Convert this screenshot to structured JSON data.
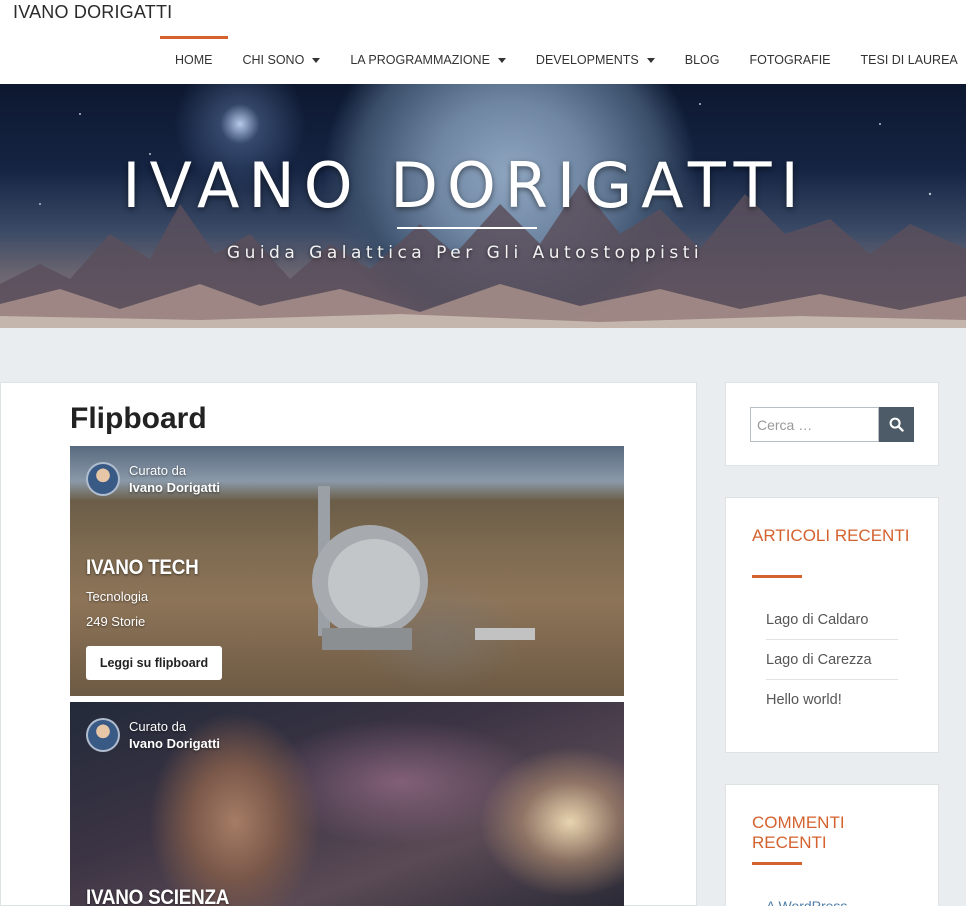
{
  "header": {
    "site_title": "IVANO DORIGATTI",
    "nav": [
      {
        "label": "HOME",
        "has_dropdown": false,
        "active": true
      },
      {
        "label": "CHI SONO",
        "has_dropdown": true,
        "active": false
      },
      {
        "label": "LA PROGRAMMAZIONE",
        "has_dropdown": true,
        "active": false
      },
      {
        "label": "DEVELOPMENTS",
        "has_dropdown": true,
        "active": false
      },
      {
        "label": "BLOG",
        "has_dropdown": false,
        "active": false
      },
      {
        "label": "FOTOGRAFIE",
        "has_dropdown": false,
        "active": false
      },
      {
        "label": "TESI DI LAUREA",
        "has_dropdown": false,
        "active": false
      }
    ]
  },
  "hero": {
    "title": "IVANO DORIGATTI",
    "tagline": "Guida Galattica Per Gli Autostoppisti"
  },
  "main": {
    "page_title": "Flipboard",
    "cards": [
      {
        "curated_label": "Curato da",
        "curator": "Ivano Dorigatti",
        "title": "IVANO TECH",
        "category": "Tecnologia",
        "stories": "249 Storie",
        "button": "Leggi su flipboard"
      },
      {
        "curated_label": "Curato da",
        "curator": "Ivano Dorigatti",
        "title": "IVANO SCIENZA"
      }
    ]
  },
  "sidebar": {
    "search_placeholder": "Cerca …",
    "recent_posts": {
      "title": "ARTICOLI RECENTI",
      "items": [
        "Lago di Caldaro",
        "Lago di Carezza",
        "Hello world!"
      ]
    },
    "recent_comments": {
      "title": "COMMENTI RECENTI",
      "items": [
        "A WordPress"
      ]
    }
  },
  "colors": {
    "accent": "#d4622f",
    "search_button": "#4c5b67",
    "link": "#4d7fab"
  }
}
